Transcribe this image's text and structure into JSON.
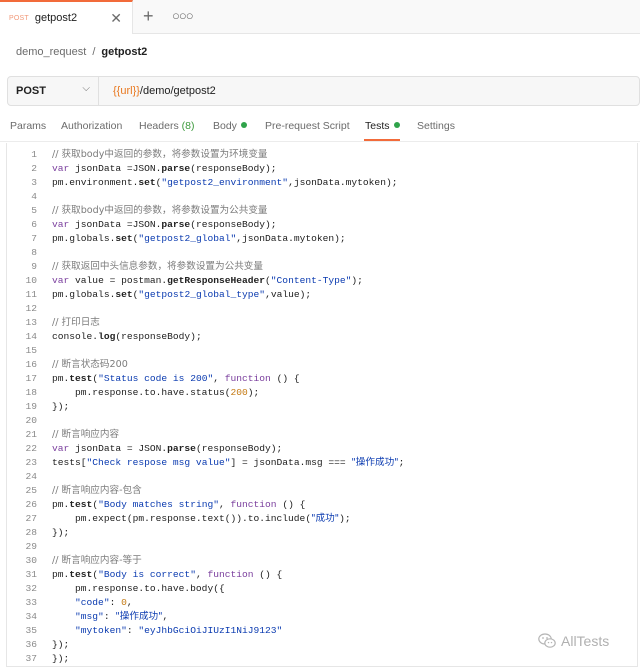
{
  "tabbar": {
    "tab": {
      "method": "POST",
      "name": "getpost2"
    },
    "new_tab": "+",
    "more": "ooo"
  },
  "breadcrumb": {
    "parent": "demo_request",
    "separator": "/",
    "current": "getpost2"
  },
  "urlbar": {
    "method": "POST",
    "url_var": "{{url}}",
    "url_path": "/demo/getpost2"
  },
  "request_tabs": [
    {
      "label": "Params"
    },
    {
      "label": "Authorization"
    },
    {
      "label": "Headers",
      "count": "(8)"
    },
    {
      "label": "Body",
      "dot": true
    },
    {
      "label": "Pre-request Script"
    },
    {
      "label": "Tests",
      "dot": true,
      "active": true
    },
    {
      "label": "Settings"
    }
  ],
  "code_lines": [
    {
      "n": "1",
      "text": "// 获取body中返回的参数，将参数设置为环境变量"
    },
    {
      "n": "2",
      "text": "var jsonData =JSON.parse(responseBody);"
    },
    {
      "n": "3",
      "text": "pm.environment.set(\"getpost2_environment\",jsonData.mytoken);"
    },
    {
      "n": "4",
      "text": ""
    },
    {
      "n": "5",
      "text": "// 获取body中返回的参数，将参数设置为公共变量"
    },
    {
      "n": "6",
      "text": "var jsonData =JSON.parse(responseBody);"
    },
    {
      "n": "7",
      "text": "pm.globals.set(\"getpost2_global\",jsonData.mytoken);"
    },
    {
      "n": "8",
      "text": ""
    },
    {
      "n": "9",
      "text": "// 获取返回中头信息参数，将参数设置为公共变量"
    },
    {
      "n": "10",
      "text": "var value = postman.getResponseHeader(\"Content-Type\");"
    },
    {
      "n": "11",
      "text": "pm.globals.set(\"getpost2_global_type\",value);"
    },
    {
      "n": "12",
      "text": ""
    },
    {
      "n": "13",
      "text": "// 打印日志"
    },
    {
      "n": "14",
      "text": "console.log(responseBody);"
    },
    {
      "n": "15",
      "text": ""
    },
    {
      "n": "16",
      "text": "// 断言状态码200"
    },
    {
      "n": "17",
      "text": "pm.test(\"Status code is 200\", function () {"
    },
    {
      "n": "18",
      "text": "    pm.response.to.have.status(200);"
    },
    {
      "n": "19",
      "text": "});"
    },
    {
      "n": "20",
      "text": ""
    },
    {
      "n": "21",
      "text": "// 断言响应内容"
    },
    {
      "n": "22",
      "text": "var jsonData = JSON.parse(responseBody);"
    },
    {
      "n": "23",
      "text": "tests[\"Check respose msg value\"] = jsonData.msg === \"操作成功\";"
    },
    {
      "n": "24",
      "text": ""
    },
    {
      "n": "25",
      "text": "// 断言响应内容-包含"
    },
    {
      "n": "26",
      "text": "pm.test(\"Body matches string\", function () {"
    },
    {
      "n": "27",
      "text": "    pm.expect(pm.response.text()).to.include(\"成功\");"
    },
    {
      "n": "28",
      "text": "});"
    },
    {
      "n": "29",
      "text": ""
    },
    {
      "n": "30",
      "text": "// 断言响应内容-等于"
    },
    {
      "n": "31",
      "text": "pm.test(\"Body is correct\", function () {"
    },
    {
      "n": "32",
      "text": "    pm.response.to.have.body({"
    },
    {
      "n": "33",
      "text": "    \"code\": 0,"
    },
    {
      "n": "34",
      "text": "    \"msg\": \"操作成功\","
    },
    {
      "n": "35",
      "text": "    \"mytoken\": \"eyJhbGciOiJIUzI1NiJ9123\""
    },
    {
      "n": "36",
      "text": "});"
    },
    {
      "n": "37",
      "text": "});"
    }
  ],
  "watermark": "AllTests",
  "colors": {
    "accent": "#f26b3a",
    "dot_green": "#2fa34a",
    "string": "#0b3bb0",
    "keyword": "#7a3e9d",
    "comment": "#7c7c7c",
    "number": "#c47a14",
    "var_orange": "#e9781f"
  },
  "icons": {
    "close": "close-icon",
    "chevron": "chevron-down-icon",
    "watermark": "wechat-icon"
  }
}
